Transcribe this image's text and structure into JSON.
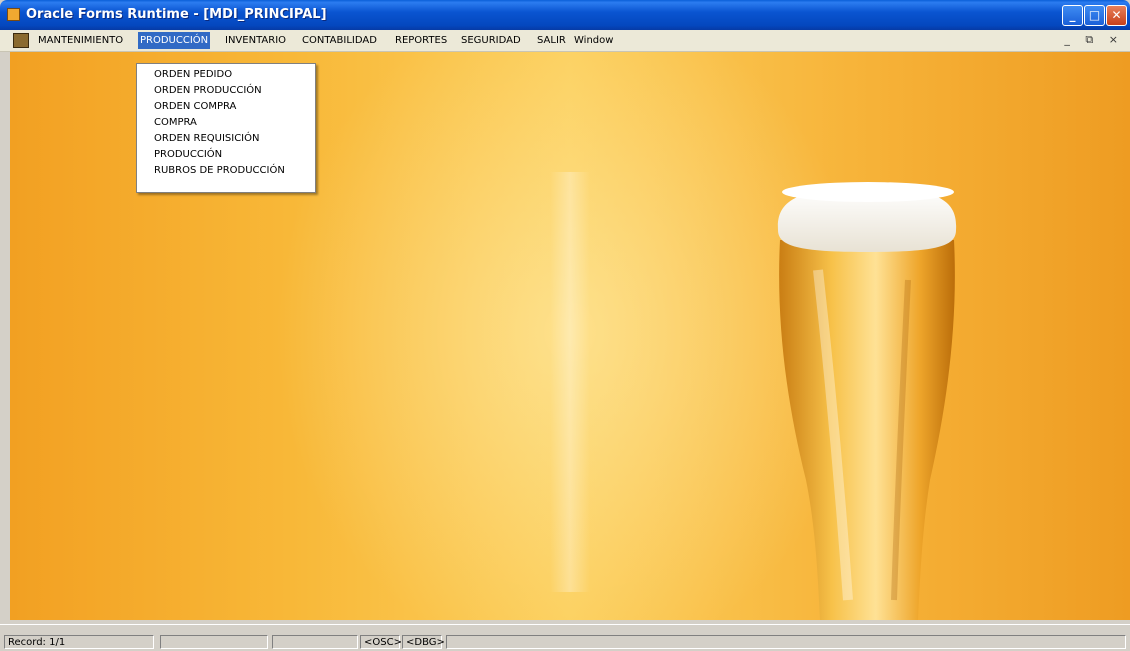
{
  "window": {
    "title": "Oracle Forms Runtime - [MDI_PRINCIPAL]",
    "minimize_glyph": "_",
    "maximize_glyph": "□",
    "close_glyph": "✕"
  },
  "menubar": {
    "items": [
      "MANTENIMIENTO",
      "PRODUCCIÓN",
      "INVENTARIO",
      "CONTABILIDAD",
      "REPORTES",
      "SEGURIDAD",
      "SALIR",
      "Window"
    ],
    "active_item": "PRODUCCIÓN",
    "mdi_controls": "_ ⧉ ×"
  },
  "dropdown": {
    "items": [
      "ORDEN PEDIDO",
      "ORDEN PRODUCCIÓN",
      "ORDEN COMPRA",
      "COMPRA",
      "ORDEN REQUISICIÓN",
      "PRODUCCIÓN",
      "RUBROS DE PRODUCCIÓN"
    ]
  },
  "statusbar": {
    "record": "Record: 1/1",
    "cell2": "",
    "cell3": "",
    "osc": "<OSC>",
    "dbg": "<DBG>",
    "cell6": ""
  },
  "colors": {
    "titlebar": "#0a55d1",
    "menu_highlight": "#316ac5",
    "background_amber": "#f7b43a"
  }
}
